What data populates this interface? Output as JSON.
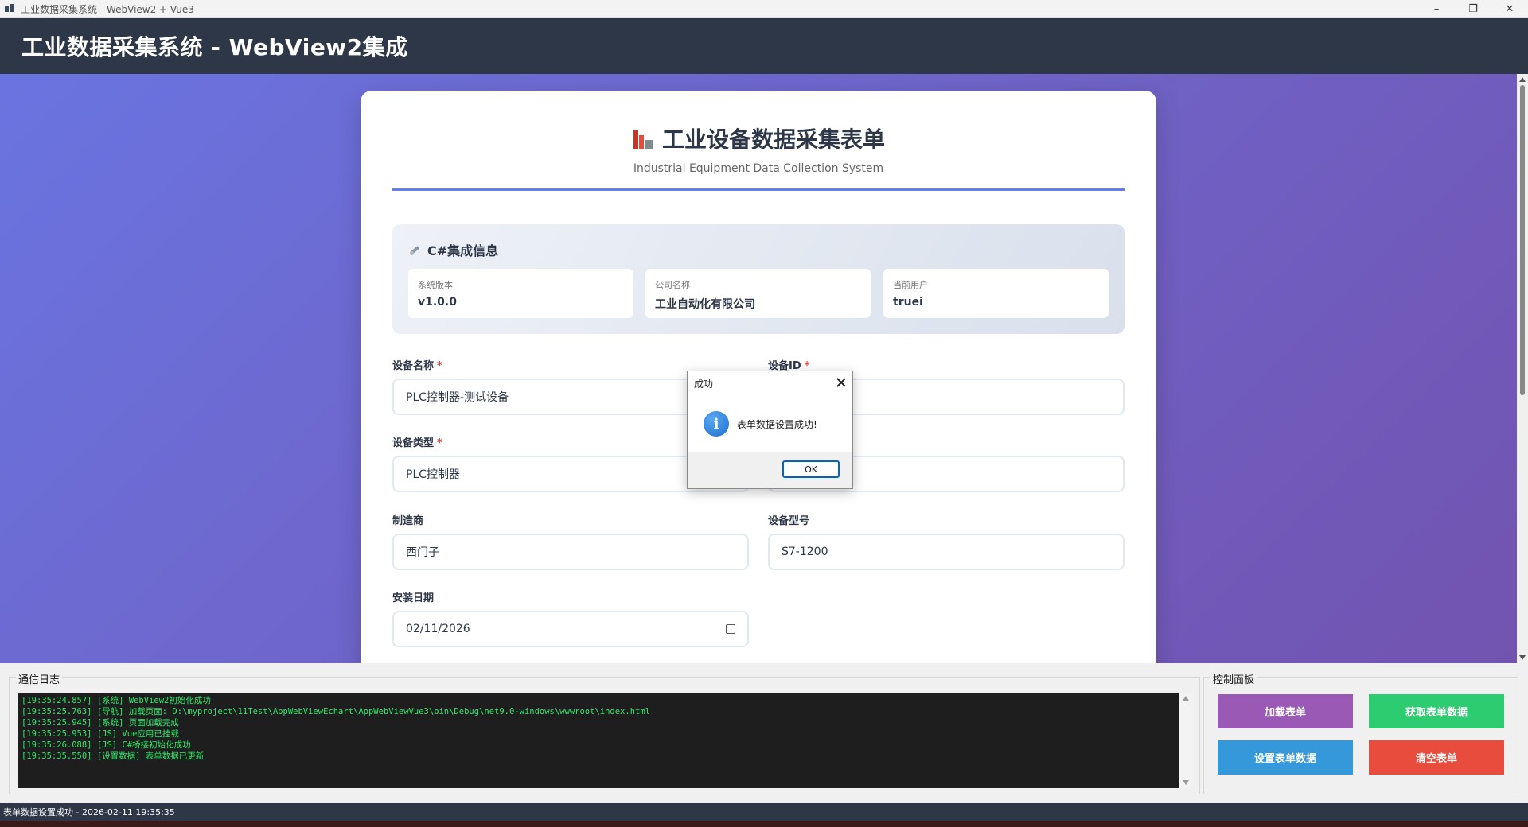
{
  "window": {
    "title": "工业数据采集系统 - WebView2 + Vue3",
    "minimize": "–",
    "maximize": "❐",
    "close": "✕"
  },
  "header": {
    "title": "工业数据采集系统 - WebView2集成"
  },
  "form": {
    "title": "工业设备数据采集表单",
    "subtitle": "Industrial Equipment Data Collection System",
    "csharp_panel": {
      "title": "C#集成信息",
      "items": [
        {
          "label": "系统版本",
          "value": "v1.0.0"
        },
        {
          "label": "公司名称",
          "value": "工业自动化有限公司"
        },
        {
          "label": "当前用户",
          "value": "truei"
        }
      ]
    },
    "fields": {
      "device_name": {
        "label": "设备名称",
        "required": "*",
        "value": "PLC控制器-测试设备"
      },
      "device_id": {
        "label": "设备ID",
        "required": "*",
        "value": ""
      },
      "device_type": {
        "label": "设备类型",
        "required": "*",
        "value": "PLC控制器"
      },
      "other": {
        "value": ""
      },
      "manufacturer": {
        "label": "制造商",
        "value": "西门子"
      },
      "model": {
        "label": "设备型号",
        "value": "S7-1200"
      },
      "install_date": {
        "label": "安装日期",
        "value": "02/11/2026"
      }
    }
  },
  "dialog": {
    "title": "成功",
    "icon": "i",
    "message": "表单数据设置成功!",
    "ok": "OK"
  },
  "log": {
    "label": "通信日志",
    "lines": [
      "[19:35:24.857] [系统] WebView2初始化成功",
      "[19:35:25.763] [导航] 加载页面: D:\\myproject\\11Test\\AppWebViewEchart\\AppWebViewVue3\\bin\\Debug\\net9.0-windows\\wwwroot\\index.html",
      "[19:35:25.945] [系统] 页面加载完成",
      "[19:35:25.953] [JS] Vue应用已挂载",
      "[19:35:26.088] [JS] C#桥接初始化成功",
      "[19:35:35.550] [设置数据] 表单数据已更新"
    ]
  },
  "control": {
    "label": "控制面板",
    "load": "加载表单",
    "get": "获取表单数据",
    "set": "设置表单数据",
    "clear": "清空表单",
    "colors": {
      "load": "#9b59b6",
      "get": "#2ecc71",
      "set": "#3498db",
      "clear": "#e74c3c"
    }
  },
  "status": {
    "text": "表单数据设置成功 - 2026-02-11 19:35:35"
  }
}
